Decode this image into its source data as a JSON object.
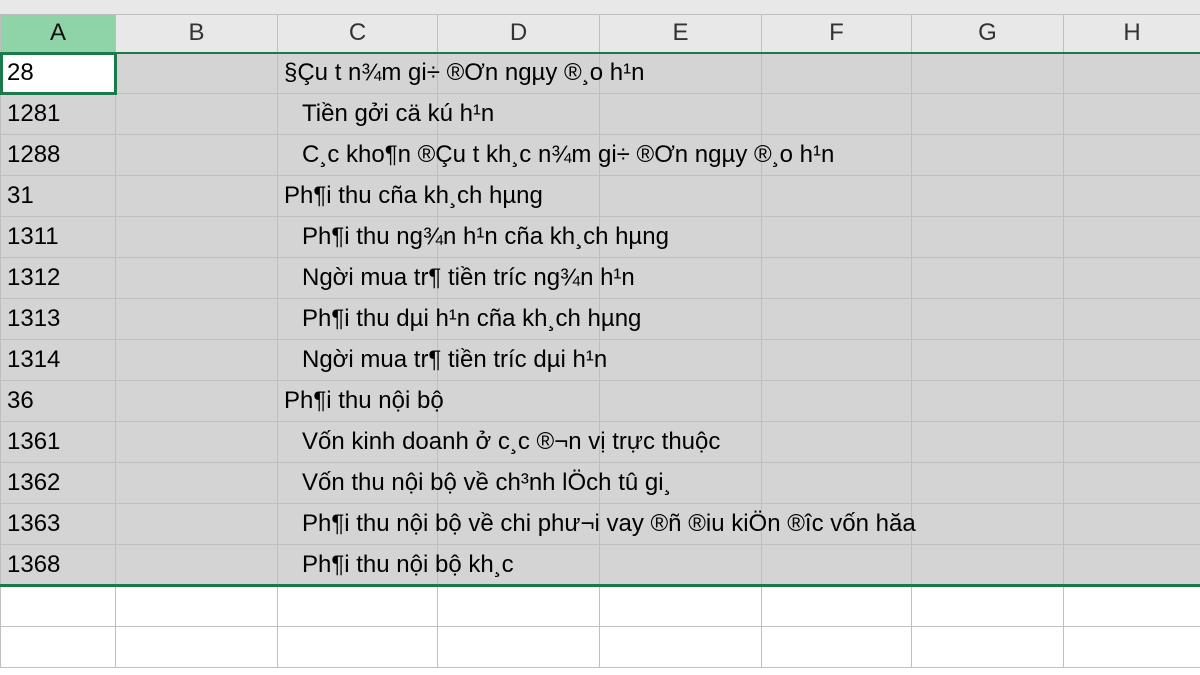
{
  "columns": [
    "A",
    "B",
    "C",
    "D",
    "E",
    "F",
    "G",
    "H"
  ],
  "active_column": "A",
  "rows": [
    {
      "a": "28",
      "c": "§Çu t­ n¾m gi÷ ®Ơn ngµy ®¸o h¹n",
      "indent": false
    },
    {
      "a": "1281",
      "c": "Tiền gởi cä kú h¹n",
      "indent": true
    },
    {
      "a": "1288",
      "c": "C¸c kho¶n ®Çu t­ kh¸c n¾m gi÷ ®Ơn ngµy ®¸o h¹n",
      "indent": true
    },
    {
      "a": "31",
      "c": "Ph¶i thu cña kh¸ch hµng",
      "indent": false
    },
    {
      "a": "1311",
      "c": "Ph¶i thu ng¾n h¹n cña kh¸ch hµng",
      "indent": true
    },
    {
      "a": "1312",
      "c": "Ng­ời mua tr¶ tiền tr­íc ng¾n h¹n",
      "indent": true
    },
    {
      "a": "1313",
      "c": "Ph¶i thu dµi h¹n cña kh¸ch hµng",
      "indent": true
    },
    {
      "a": "1314",
      "c": "Ng­ời mua tr¶ tiền tr­íc dµi h¹n",
      "indent": true
    },
    {
      "a": "36",
      "c": "Ph¶i thu nội bộ",
      "indent": false
    },
    {
      "a": "1361",
      "c": "Vốn kinh doanh ở c¸c ®¬n vị trực thuộc",
      "indent": true
    },
    {
      "a": "1362",
      "c": "Vốn thu nội bộ về ch³nh lÖch tû gi¸",
      "indent": true
    },
    {
      "a": "1363",
      "c": "Ph¶i thu nội bộ về chi phư¬i vay ®ñ ®iu kiÖn ®­îc vốn hăa",
      "indent": true
    },
    {
      "a": "1368",
      "c": "Ph¶i thu nội bộ kh¸c",
      "indent": true
    }
  ],
  "blank_rows": 2
}
